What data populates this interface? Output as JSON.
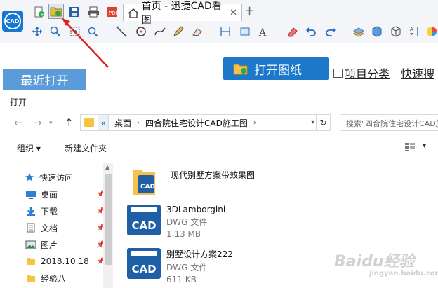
{
  "app": {
    "tab_title": "首页 - 迅捷CAD看图",
    "logo_text": "CAD",
    "open_drawing_label": "打开图纸",
    "project_category_label": "项目分类",
    "quick_search_label": "快速搜",
    "recent_label": "最近打开"
  },
  "dialog": {
    "title": "打开",
    "breadcrumb": [
      "桌面",
      "四合院住宅设计CAD施工图"
    ],
    "search_placeholder": "搜索\"四合院住宅设计CAD施",
    "organize_label": "组织",
    "new_folder_label": "新建文件夹"
  },
  "sidebar": {
    "items": [
      {
        "label": "快速访问",
        "icon": "star-icon"
      },
      {
        "label": "桌面",
        "icon": "desktop-icon"
      },
      {
        "label": "下载",
        "icon": "download-icon"
      },
      {
        "label": "文档",
        "icon": "document-icon"
      },
      {
        "label": "图片",
        "icon": "picture-icon"
      },
      {
        "label": "2018.10.18",
        "icon": "folder-icon"
      },
      {
        "label": "经验八",
        "icon": "folder-icon"
      }
    ]
  },
  "files": [
    {
      "name": "现代别墅方案带效果图",
      "type": "",
      "size": ""
    },
    {
      "name": "3DLamborgini",
      "type": "DWG 文件",
      "size": "1.13 MB"
    },
    {
      "name": "别墅设计方案222",
      "type": "DWG 文件",
      "size": "611 KB"
    }
  ],
  "watermark": {
    "text": "Baidu经验",
    "sub": "jingyan.baidu.com"
  },
  "colors": {
    "accent": "#1c78c8",
    "recent_tab": "#5b9bd9",
    "cad_icon": "#1e5fa5"
  }
}
